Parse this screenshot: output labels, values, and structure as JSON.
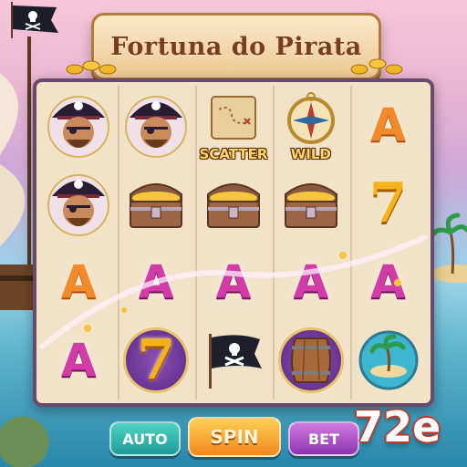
{
  "title": "Fortuna do Pirata",
  "symbols": {
    "scatter_label": "SCATTER",
    "wild_label": "WILD",
    "letter_a": "A",
    "seven": "7"
  },
  "buttons": {
    "auto": "AUTO",
    "spin": "SPIN",
    "bet": "BET"
  },
  "win_amount": "72e",
  "colors": {
    "reel_border": "#6a4a6b",
    "reel_background": "#f2e3c8",
    "letter_orange": "#f38a2a",
    "letter_purple": "#d33ba8",
    "auto_button": "#1f9b9a",
    "spin_button": "#f08a1c",
    "bet_button": "#8c34b0"
  },
  "reel_grid": [
    [
      "pirate",
      "pirate",
      "scatter-map",
      "wild-compass",
      "letter-a-orange"
    ],
    [
      "pirate",
      "treasure-chest",
      "treasure-chest",
      "treasure-chest",
      "seven"
    ],
    [
      "letter-a-orange",
      "letter-a-purple",
      "letter-a-purple",
      "letter-a-purple",
      "letter-a-purple"
    ],
    [
      "letter-a-purple",
      "seven",
      "jolly-roger-flag",
      "barrel",
      "island"
    ]
  ]
}
